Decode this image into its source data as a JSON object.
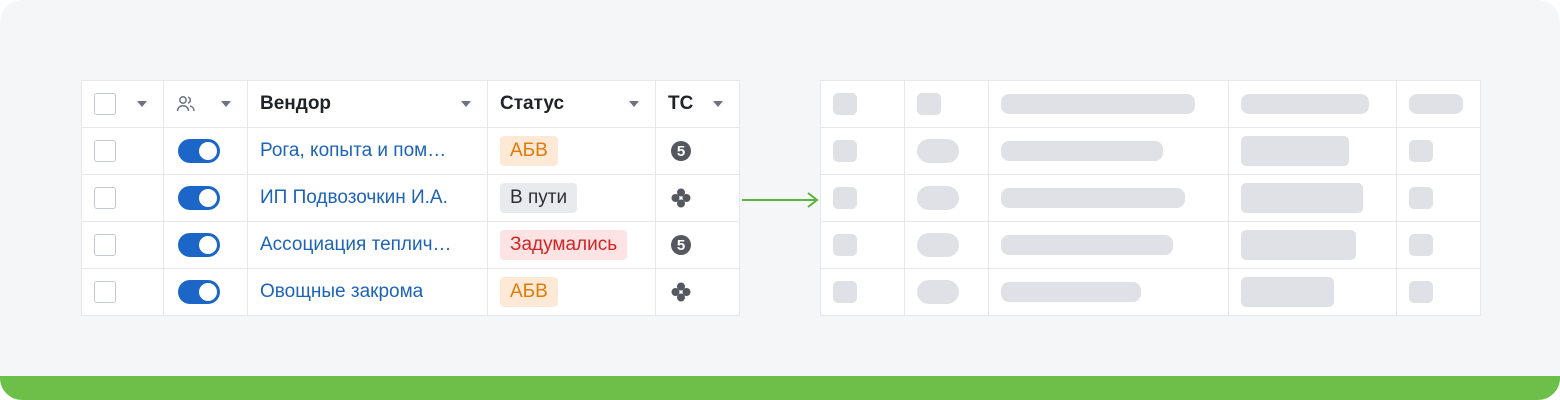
{
  "table": {
    "columns": [
      {
        "label": "",
        "type": "checkbox"
      },
      {
        "label": "",
        "icon": "users-icon"
      },
      {
        "label": "Вендор"
      },
      {
        "label": "Статус"
      },
      {
        "label": "ТС"
      }
    ],
    "rows": [
      {
        "vendor": "Рога, копыта и пом…",
        "status": "АБВ",
        "status_color": "#e07b0a",
        "ts_icon": "five-circle-icon",
        "enabled": true
      },
      {
        "vendor": "ИП Подвозочкин И.А.",
        "status": "В пути",
        "status_color": "#2b2f36",
        "ts_icon": "cluster-icon",
        "enabled": true
      },
      {
        "vendor": "Ассоциация теплич…",
        "status": "Задумались",
        "status_color": "#d12525",
        "ts_icon": "five-circle-icon",
        "enabled": true
      },
      {
        "vendor": "Овощные закрома",
        "status": "АБВ",
        "status_color": "#e07b0a",
        "ts_icon": "cluster-icon",
        "enabled": true
      }
    ]
  },
  "colors": {
    "accent": "#1c66c8",
    "link": "#1d63b8",
    "arrow": "#5bb342",
    "bottom_bar": "#6cc04a",
    "skeleton": "#dfe1e6"
  }
}
